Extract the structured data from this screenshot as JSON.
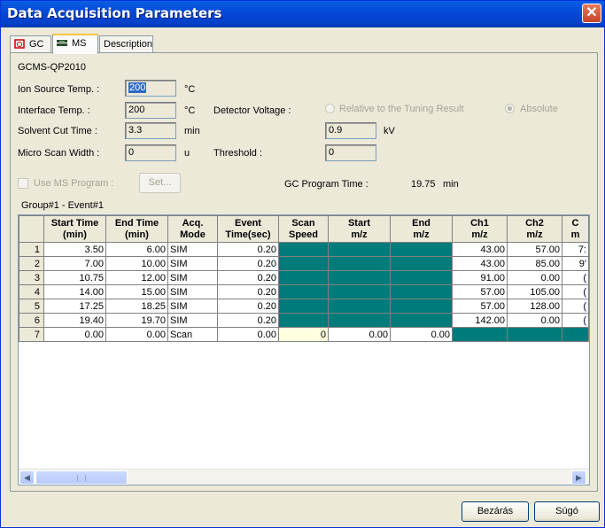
{
  "window": {
    "title": "Data Acquisition Parameters",
    "close_glyph": "✕"
  },
  "tabs": [
    {
      "label": "GC"
    },
    {
      "label": "MS"
    },
    {
      "label": "Description"
    }
  ],
  "ms": {
    "instrument": "GCMS-QP2010",
    "ion_source_temp_label": "Ion Source Temp. :",
    "ion_source_temp_value": "200",
    "ion_source_temp_unit": "°C",
    "interface_temp_label": "Interface Temp. :",
    "interface_temp_value": "200",
    "interface_temp_unit": "°C",
    "detector_voltage_label": "Detector Voltage :",
    "relative_label": "Relative to the Tuning Result",
    "absolute_label": "Absolute",
    "detector_voltage_value": "0.9",
    "detector_voltage_unit": "kV",
    "solvent_cut_label": "Solvent Cut Time :",
    "solvent_cut_value": "3.3",
    "solvent_cut_unit": "min",
    "micro_scan_label": "Micro Scan Width :",
    "micro_scan_value": "0",
    "micro_scan_unit": "u",
    "threshold_label": "Threshold :",
    "threshold_value": "0",
    "use_ms_program_label": "Use MS Program :",
    "set_button": "Set...",
    "gc_program_time_label": "GC Program Time :",
    "gc_program_time_value": "19.75",
    "gc_program_time_unit": "min",
    "group_event": "Group#1 - Event#1"
  },
  "table": {
    "headers": [
      [
        "Start Time",
        "(min)"
      ],
      [
        "End Time",
        "(min)"
      ],
      [
        "Acq.",
        "Mode"
      ],
      [
        "Event",
        "Time(sec)"
      ],
      [
        "Scan",
        "Speed"
      ],
      [
        "Start",
        "m/z"
      ],
      [
        "End",
        "m/z"
      ],
      [
        "Ch1",
        "m/z"
      ],
      [
        "Ch2",
        "m/z"
      ],
      [
        "C",
        "m"
      ]
    ],
    "rows": [
      {
        "n": "1",
        "start": "3.50",
        "end": "6.00",
        "mode": "SIM",
        "event": "0.20",
        "speed": "",
        "smz": "",
        "emz": "",
        "ch1": "43.00",
        "ch2": "57.00",
        "ch3": "7:"
      },
      {
        "n": "2",
        "start": "7.00",
        "end": "10.00",
        "mode": "SIM",
        "event": "0.20",
        "speed": "",
        "smz": "",
        "emz": "",
        "ch1": "43.00",
        "ch2": "85.00",
        "ch3": "9'"
      },
      {
        "n": "3",
        "start": "10.75",
        "end": "12.00",
        "mode": "SIM",
        "event": "0.20",
        "speed": "",
        "smz": "",
        "emz": "",
        "ch1": "91.00",
        "ch2": "0.00",
        "ch3": "("
      },
      {
        "n": "4",
        "start": "14.00",
        "end": "15.00",
        "mode": "SIM",
        "event": "0.20",
        "speed": "",
        "smz": "",
        "emz": "",
        "ch1": "57.00",
        "ch2": "105.00",
        "ch3": "("
      },
      {
        "n": "5",
        "start": "17.25",
        "end": "18.25",
        "mode": "SIM",
        "event": "0.20",
        "speed": "",
        "smz": "",
        "emz": "",
        "ch1": "57.00",
        "ch2": "128.00",
        "ch3": "("
      },
      {
        "n": "6",
        "start": "19.40",
        "end": "19.70",
        "mode": "SIM",
        "event": "0.20",
        "speed": "",
        "smz": "",
        "emz": "",
        "ch1": "142.00",
        "ch2": "0.00",
        "ch3": "("
      },
      {
        "n": "7",
        "start": "0.00",
        "end": "0.00",
        "mode": "Scan",
        "event": "0.00",
        "speed": "0",
        "smz": "0.00",
        "emz": "0.00",
        "ch1": "",
        "ch2": "",
        "ch3": ""
      }
    ],
    "empty_rows": 8
  },
  "footer": {
    "close_button": "Bezárás",
    "help_button": "Súgó"
  },
  "colors": {
    "teal": "#007b7b",
    "title_blue": "#0448d6",
    "close_red": "#c8432b"
  }
}
